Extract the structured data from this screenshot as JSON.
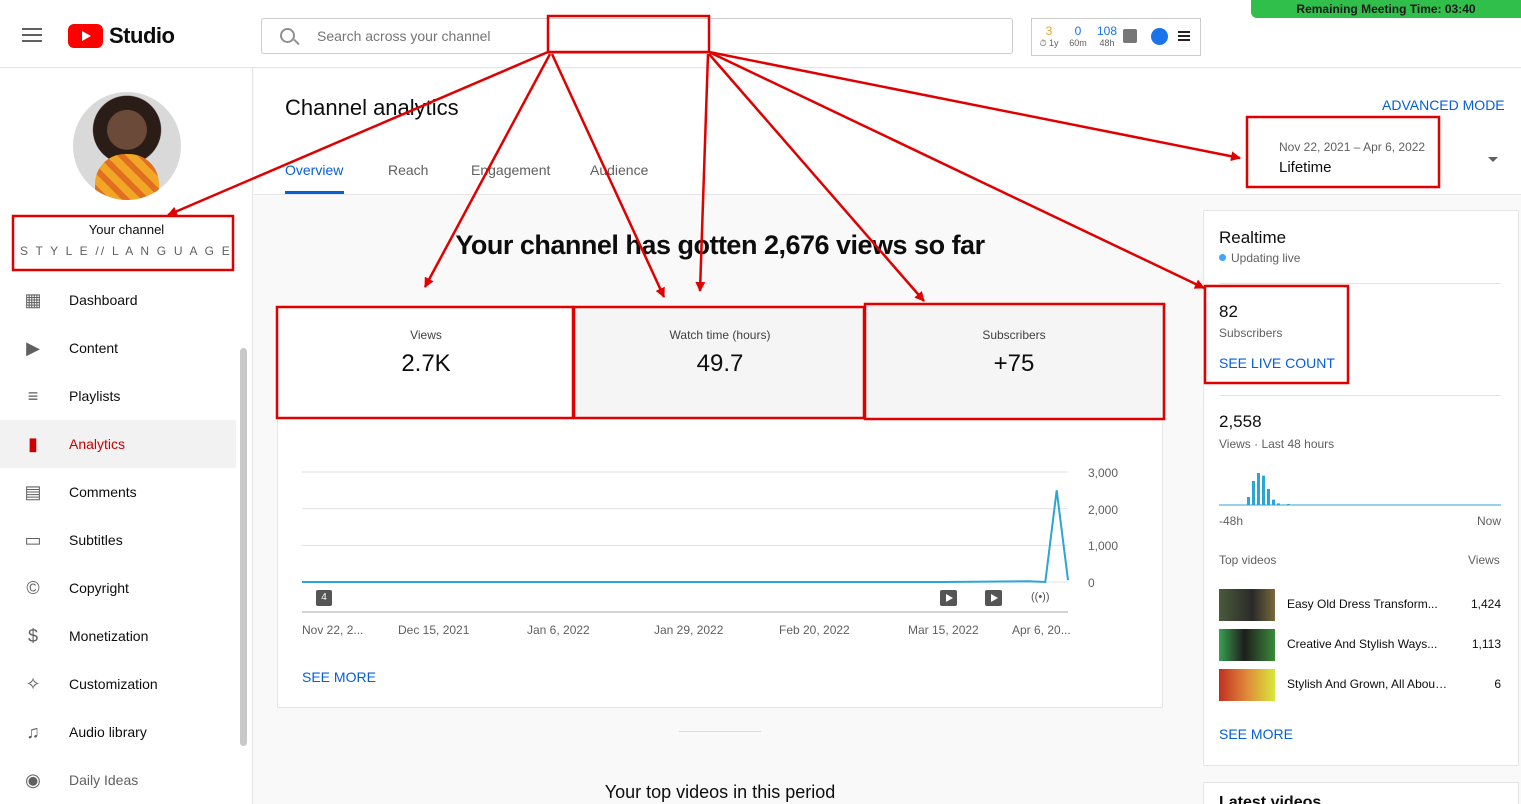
{
  "header": {
    "app_name": "Studio",
    "search_placeholder": "Search across your channel",
    "ext_stats": [
      {
        "value": "3",
        "sub": "⏱ 1y",
        "color": "#f2a626"
      },
      {
        "value": "0",
        "sub": "60m",
        "color": "#1a73e8"
      },
      {
        "value": "108",
        "sub": "48h",
        "color": "#1a73e8"
      }
    ],
    "meeting_banner": "Remaining Meeting Time: 03:40"
  },
  "sidebar": {
    "channel_title": "Your channel",
    "channel_name": "S T Y L E // L A N G U A G E // WITH ...",
    "items": [
      {
        "label": "Dashboard",
        "icon": "dashboard-icon"
      },
      {
        "label": "Content",
        "icon": "content-icon"
      },
      {
        "label": "Playlists",
        "icon": "playlists-icon"
      },
      {
        "label": "Analytics",
        "icon": "analytics-icon",
        "active": true
      },
      {
        "label": "Comments",
        "icon": "comments-icon"
      },
      {
        "label": "Subtitles",
        "icon": "subtitles-icon"
      },
      {
        "label": "Copyright",
        "icon": "copyright-icon"
      },
      {
        "label": "Monetization",
        "icon": "monetization-icon"
      },
      {
        "label": "Customization",
        "icon": "customization-icon"
      },
      {
        "label": "Audio library",
        "icon": "audio-library-icon"
      },
      {
        "label": "Daily Ideas",
        "icon": "daily-ideas-icon"
      }
    ]
  },
  "main": {
    "title": "Channel analytics",
    "tabs": [
      "Overview",
      "Reach",
      "Engagement",
      "Audience"
    ],
    "advanced_mode": "ADVANCED MODE",
    "date_range": "Nov 22, 2021 – Apr 6, 2022",
    "date_label": "Lifetime",
    "headline": "Your channel has gotten 2,676 views so far",
    "metrics": [
      {
        "label": "Views",
        "value": "2.7K"
      },
      {
        "label": "Watch time (hours)",
        "value": "49.7"
      },
      {
        "label": "Subscribers",
        "value": "+75"
      }
    ],
    "chart_x_labels": [
      "Nov 22, 2...",
      "Dec 15, 2021",
      "Jan 6, 2022",
      "Jan 29, 2022",
      "Feb 20, 2022",
      "Mar 15, 2022",
      "Apr 6, 20..."
    ],
    "chart_y_labels": [
      "3,000",
      "2,000",
      "1,000",
      "0"
    ],
    "chart_badge": "4",
    "see_more": "SEE MORE",
    "top_videos_heading": "Your top videos in this period"
  },
  "realtime": {
    "title": "Realtime",
    "status": "Updating live",
    "subscribers": "82",
    "subscribers_label": "Subscribers",
    "live_count": "SEE LIVE COUNT",
    "views": "2,558",
    "views_label": "Views · Last 48 hours",
    "axis_start": "-48h",
    "axis_end": "Now",
    "top_videos_label": "Top videos",
    "views_column": "Views",
    "videos": [
      {
        "title": "Easy Old Dress Transform...",
        "views": "1,424"
      },
      {
        "title": "Creative And Stylish Ways...",
        "views": "1,113"
      },
      {
        "title": "Stylish And Grown, All About ...",
        "views": "6"
      }
    ],
    "see_more": "SEE MORE",
    "latest_videos": "Latest videos"
  },
  "colors": {
    "accent": "#065fd4",
    "brand": "#ff0000",
    "annotation": "#e00000",
    "chart_line": "#2ca5d6"
  },
  "chart_data": [
    {
      "type": "line",
      "title": "",
      "x": [
        "Nov 22, 2021",
        "Dec 15, 2021",
        "Jan 6, 2022",
        "Jan 29, 2022",
        "Feb 20, 2022",
        "Mar 15, 2022",
        "Mar 30, 2022",
        "Apr 2, 2022",
        "Apr 4, 2022",
        "Apr 6, 2022"
      ],
      "series": [
        {
          "values": [
            0,
            0,
            0,
            0,
            0,
            0,
            20,
            0,
            2500,
            50
          ]
        }
      ],
      "ylim": [
        0,
        3000
      ],
      "ytick_labels": [
        "0",
        "1,000",
        "2,000",
        "3,000"
      ],
      "grid": true
    },
    {
      "type": "bar",
      "title": "",
      "xlabel_start": "-48h",
      "xlabel_end": "Now",
      "categories": [
        "-47h",
        "-46h",
        "-45h",
        "-44h",
        "-43h",
        "-42h",
        "-41h",
        "-40h",
        "-39h",
        "-38h"
      ],
      "values": [
        0,
        0,
        0,
        0,
        0,
        0,
        0,
        0,
        0,
        0
      ],
      "bars_values": [
        15,
        45,
        60,
        55,
        30,
        10,
        3,
        1,
        2,
        1
      ]
    }
  ]
}
